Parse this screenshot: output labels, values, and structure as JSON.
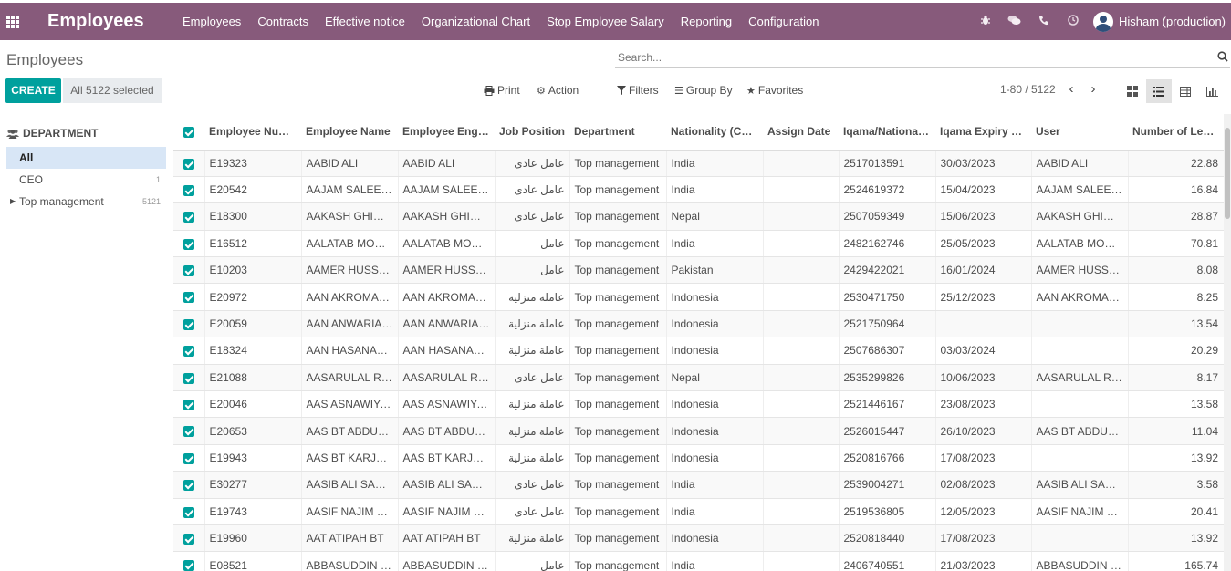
{
  "nav": {
    "app_title": "Employees",
    "menu": [
      "Employees",
      "Contracts",
      "Effective notice",
      "Organizational Chart",
      "Stop Employee Salary",
      "Reporting",
      "Configuration"
    ],
    "user_name": "Hisham (production)"
  },
  "control": {
    "breadcrumb": "Employees",
    "search_placeholder": "Search...",
    "create_label": "CREATE",
    "selected_label": "All 5122 selected",
    "print_label": "Print",
    "action_label": "Action",
    "filters_label": "Filters",
    "groupby_label": "Group By",
    "favorites_label": "Favorites",
    "pager": "1-80 / 5122"
  },
  "sidebar": {
    "header": "DEPARTMENT",
    "items": [
      {
        "label": "All",
        "count": ""
      },
      {
        "label": "CEO",
        "count": "1"
      },
      {
        "label": "Top management",
        "count": "5121"
      }
    ]
  },
  "table": {
    "columns": [
      "Employee Number",
      "Employee Name",
      "Employee English Name",
      "Job Position",
      "Department",
      "Nationality (Country)",
      "Assign Date",
      "Iqama/National ID",
      "Iqama Expiry Date",
      "User",
      "Number of Leave Days"
    ],
    "rows": [
      [
        "E19323",
        "AABID ALI",
        "AABID ALI",
        "عامل عادى",
        "Top management",
        "India",
        "",
        "2517013591",
        "30/03/2023",
        "AABID ALI",
        "22.88"
      ],
      [
        "E20542",
        "AAJAM SALEEM AHMED",
        "AAJAM SALEEM AHMED",
        "عامل عادى",
        "Top management",
        "India",
        "",
        "2524619372",
        "15/04/2023",
        "AAJAM SALEEM AHMED",
        "16.84"
      ],
      [
        "E18300",
        "AAKASH GHIMIRE",
        "AAKASH GHIMIRE",
        "عامل عادى",
        "Top management",
        "Nepal",
        "",
        "2507059349",
        "15/06/2023",
        "AAKASH GHIMIRE",
        "28.87"
      ],
      [
        "E16512",
        "AALATAB MONDAL",
        "AALATAB MONDAL",
        "عامل",
        "Top management",
        "India",
        "",
        "2482162746",
        "25/05/2023",
        "AALATAB MONDAL",
        "70.81"
      ],
      [
        "E10203",
        "AAMER HUSSAIN",
        "AAMER HUSSAIN",
        "عامل",
        "Top management",
        "Pakistan",
        "",
        "2429422021",
        "16/01/2024",
        "AAMER HUSSAIN",
        "8.08"
      ],
      [
        "E20972",
        "AAN AKROMAH BINTI",
        "AAN AKROMAH BINTI",
        "عاملة منزلية",
        "Top management",
        "Indonesia",
        "",
        "2530471750",
        "25/12/2023",
        "AAN AKROMAH BINTI",
        "8.25"
      ],
      [
        "E20059",
        "AAN ANWARIAH BINTI",
        "AAN ANWARIAH BINTI",
        "عاملة منزلية",
        "Top management",
        "Indonesia",
        "",
        "2521750964",
        "",
        "",
        "13.54"
      ],
      [
        "E18324",
        "AAN HASANAH BINTI",
        "AAN HASANAH BINTI",
        "عاملة منزلية",
        "Top management",
        "Indonesia",
        "",
        "2507686307",
        "03/03/2024",
        "",
        "20.29"
      ],
      [
        "E21088",
        "AASARULAL RAJA",
        "AASARULAL RAJA",
        "عامل عادى",
        "Top management",
        "Nepal",
        "",
        "2535299826",
        "10/06/2023",
        "AASARULAL RAJA",
        "8.17"
      ],
      [
        "E20046",
        "AAS ASNAWIYAH BINTI",
        "AAS ASNAWIYAH BINTI",
        "عاملة منزلية",
        "Top management",
        "Indonesia",
        "",
        "2521446167",
        "23/08/2023",
        "",
        "13.58"
      ],
      [
        "E20653",
        "AAS BT ABDUROHIM",
        "AAS BT ABDUROHIM",
        "عاملة منزلية",
        "Top management",
        "Indonesia",
        "",
        "2526015447",
        "26/10/2023",
        "AAS BT ABDUROHIM",
        "11.04"
      ],
      [
        "E19943",
        "AAS BT KARJAYA",
        "AAS BT KARJAYA",
        "عاملة منزلية",
        "Top management",
        "Indonesia",
        "",
        "2520816766",
        "17/08/2023",
        "",
        "13.92"
      ],
      [
        "E30277",
        "AASIB ALI SAKIR",
        "AASIB ALI SAKIR",
        "عامل عادى",
        "Top management",
        "India",
        "",
        "2539004271",
        "02/08/2023",
        "AASIB ALI SAKIR",
        "3.58"
      ],
      [
        "E19743",
        "AASIF NAJIM NAJIM",
        "AASIF NAJIM NAJIM",
        "عامل عادى",
        "Top management",
        "India",
        "",
        "2519536805",
        "12/05/2023",
        "AASIF NAJIM NAJIM",
        "20.41"
      ],
      [
        "E19960",
        "AAT ATIPAH BT",
        "AAT ATIPAH BT",
        "عاملة منزلية",
        "Top management",
        "Indonesia",
        "",
        "2520818440",
        "17/08/2023",
        "",
        "13.92"
      ],
      [
        "E08521",
        "ABBASUDDIN SEKH",
        "ABBASUDDIN SEKH",
        "عامل",
        "Top management",
        "India",
        "",
        "2406740551",
        "21/03/2023",
        "ABBASUDDIN SEKH",
        "165.74"
      ]
    ]
  },
  "icons": {
    "apps": "apps-grid-icon",
    "bug": "bug-icon",
    "chat": "chat-icon",
    "phone": "phone-icon",
    "clock": "clock-icon"
  },
  "colors": {
    "navbar": "#875a7b",
    "primary": "#00a09d",
    "selected_bg": "#d8e6f6"
  }
}
